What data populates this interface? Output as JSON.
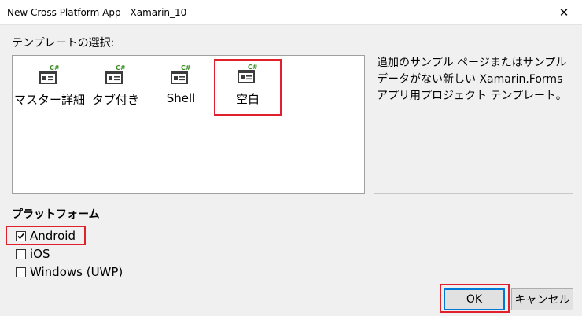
{
  "window": {
    "title": "New Cross Platform App - Xamarin_10",
    "close_glyph": "✕"
  },
  "templates": {
    "section_label": "テンプレートの選択:",
    "items": [
      {
        "label": "マスター詳細",
        "icon": "csharp-form-icon"
      },
      {
        "label": "タブ付き",
        "icon": "csharp-form-icon"
      },
      {
        "label": "Shell",
        "icon": "csharp-form-icon"
      },
      {
        "label": "空白",
        "icon": "csharp-form-icon",
        "selected": true
      }
    ],
    "description_lines": [
      "追加のサンプル ページまたはサンプル",
      "データがない新しい Xamarin.Forms",
      "アプリ用プロジェクト テンプレート。"
    ]
  },
  "platforms": {
    "section_label": "プラットフォーム",
    "items": [
      {
        "label": "Android",
        "checked": true
      },
      {
        "label": "iOS",
        "checked": false
      },
      {
        "label": "Windows (UWP)",
        "checked": false
      }
    ]
  },
  "buttons": {
    "ok": "OK",
    "cancel": "キャンセル"
  },
  "colors": {
    "highlight": "#e0212b",
    "icon_dark": "#3c3c3c",
    "csharp_green": "#3b8c24",
    "ok_border": "#0078d7"
  }
}
